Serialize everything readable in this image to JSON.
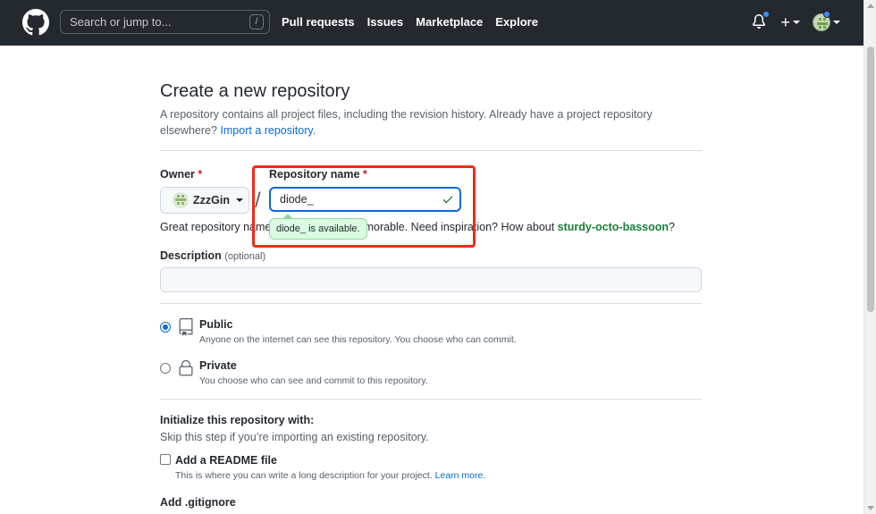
{
  "header": {
    "search_placeholder": "Search or jump to...",
    "search_shortcut": "/",
    "nav": [
      "Pull requests",
      "Issues",
      "Marketplace",
      "Explore"
    ],
    "plus": "+"
  },
  "page": {
    "title": "Create a new repository",
    "lead_text": "A repository contains all project files, including the revision history. Already have a project repository elsewhere?",
    "import_link": "Import a repository",
    "lead_period": "."
  },
  "form": {
    "owner_label": "Owner",
    "required_mark": "*",
    "owner_value": "ZzzGin",
    "separator": "/",
    "repo_label": "Repository name",
    "repo_value": "diode_",
    "availability_tooltip": "diode_ is available.",
    "hint_prefix": "Great repository names are short and memorable. Need inspiration? How about ",
    "hint_suggestion": "sturdy-octo-bassoon",
    "hint_suffix": "?",
    "description_label": "Description",
    "description_optional": "(optional)",
    "description_value": ""
  },
  "visibility": [
    {
      "title": "Public",
      "desc": "Anyone on the internet can see this repository. You choose who can commit.",
      "selected": true,
      "icon": "repo-icon"
    },
    {
      "title": "Private",
      "desc": "You choose who can see and commit to this repository.",
      "selected": false,
      "icon": "lock-icon"
    }
  ],
  "initialize": {
    "title": "Initialize this repository with:",
    "subtitle": "Skip this step if you’re importing an existing repository.",
    "readme_label": "Add a README file",
    "readme_desc": "This is where you can write a long description for your project.",
    "learn_more": "Learn more.",
    "readme_checked": false,
    "gitignore_label": "Add .gitignore"
  },
  "colors": {
    "header_bg": "#24292f",
    "link": "#0969da",
    "success": "#1a7f37",
    "highlight": "#f12b16"
  }
}
